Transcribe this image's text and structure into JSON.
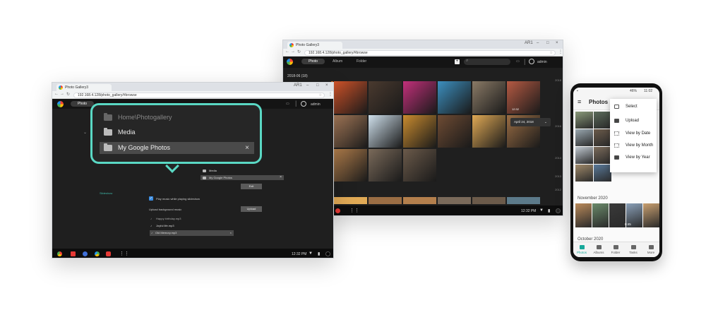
{
  "left_window": {
    "tab_title": "Photo Gallery3",
    "url": "192.168.4.128/photo_gallery/#browse",
    "nav_photo": "Photo",
    "account": "admin",
    "folder_media_small": "Media",
    "folder_google_small": "My Google Photos",
    "exit_label": "Exit",
    "slideshow_link": "Slideshow",
    "play_music_label": "Play music while playing slideshow",
    "upload_music_label": "Upload background music",
    "upload_button": "Upload",
    "songs": [
      "Happy birthday.mp3",
      "Joyful life.mp3",
      "Old Memory.mp3"
    ],
    "clock": "12:32 PM",
    "callout": {
      "path": "Home\\Photogallery",
      "media": "Media",
      "selected": "My Google Photos"
    }
  },
  "middle_window": {
    "tab_title": "Photo Gallery3",
    "url": "192.168.4.128/photo_gallery/#browse",
    "nav_tabs": [
      "Photo",
      "Album",
      "Folder"
    ],
    "account": "admin",
    "group_header": "2018-06 (18)",
    "date_popup": "April 24, 2018",
    "timeline": [
      "2018",
      "2016",
      "2014",
      "2013",
      "2012"
    ],
    "clock": "12:32 PM",
    "thumb_time": "12:32",
    "colors": {
      "thumbs": [
        "#d2542a",
        "#4a3a2f",
        "#c2307a",
        "#3c8fbf",
        "#8a7a66",
        "#b55a43",
        "#a67a59",
        "#cfe0ec",
        "#c98b2f",
        "#6e4b33",
        "#e0a955",
        "#9a6d44",
        "#b37f4c",
        "#7a6a5a",
        "#6b5a4a",
        "#5c7a8a",
        "#3a2d22",
        "#4f7f8f",
        "#8c7d6d",
        "#c8a57a",
        "#9c6a3e",
        "#7a5a3e",
        "#5a4a3a",
        "#a88a60"
      ]
    }
  },
  "phone": {
    "status_time": "11:02",
    "status_battery": "46%",
    "title": "Photos",
    "menu": [
      "Select",
      "Upload",
      "View by Date",
      "View by Month",
      "View by Year"
    ],
    "section_1": "November 2020",
    "section_2": "October 2020",
    "video_time": "0:45",
    "bottom_nav": [
      "Photos",
      "Albums",
      "Folder",
      "Tasks",
      "More"
    ],
    "accent": "#16a89a"
  }
}
